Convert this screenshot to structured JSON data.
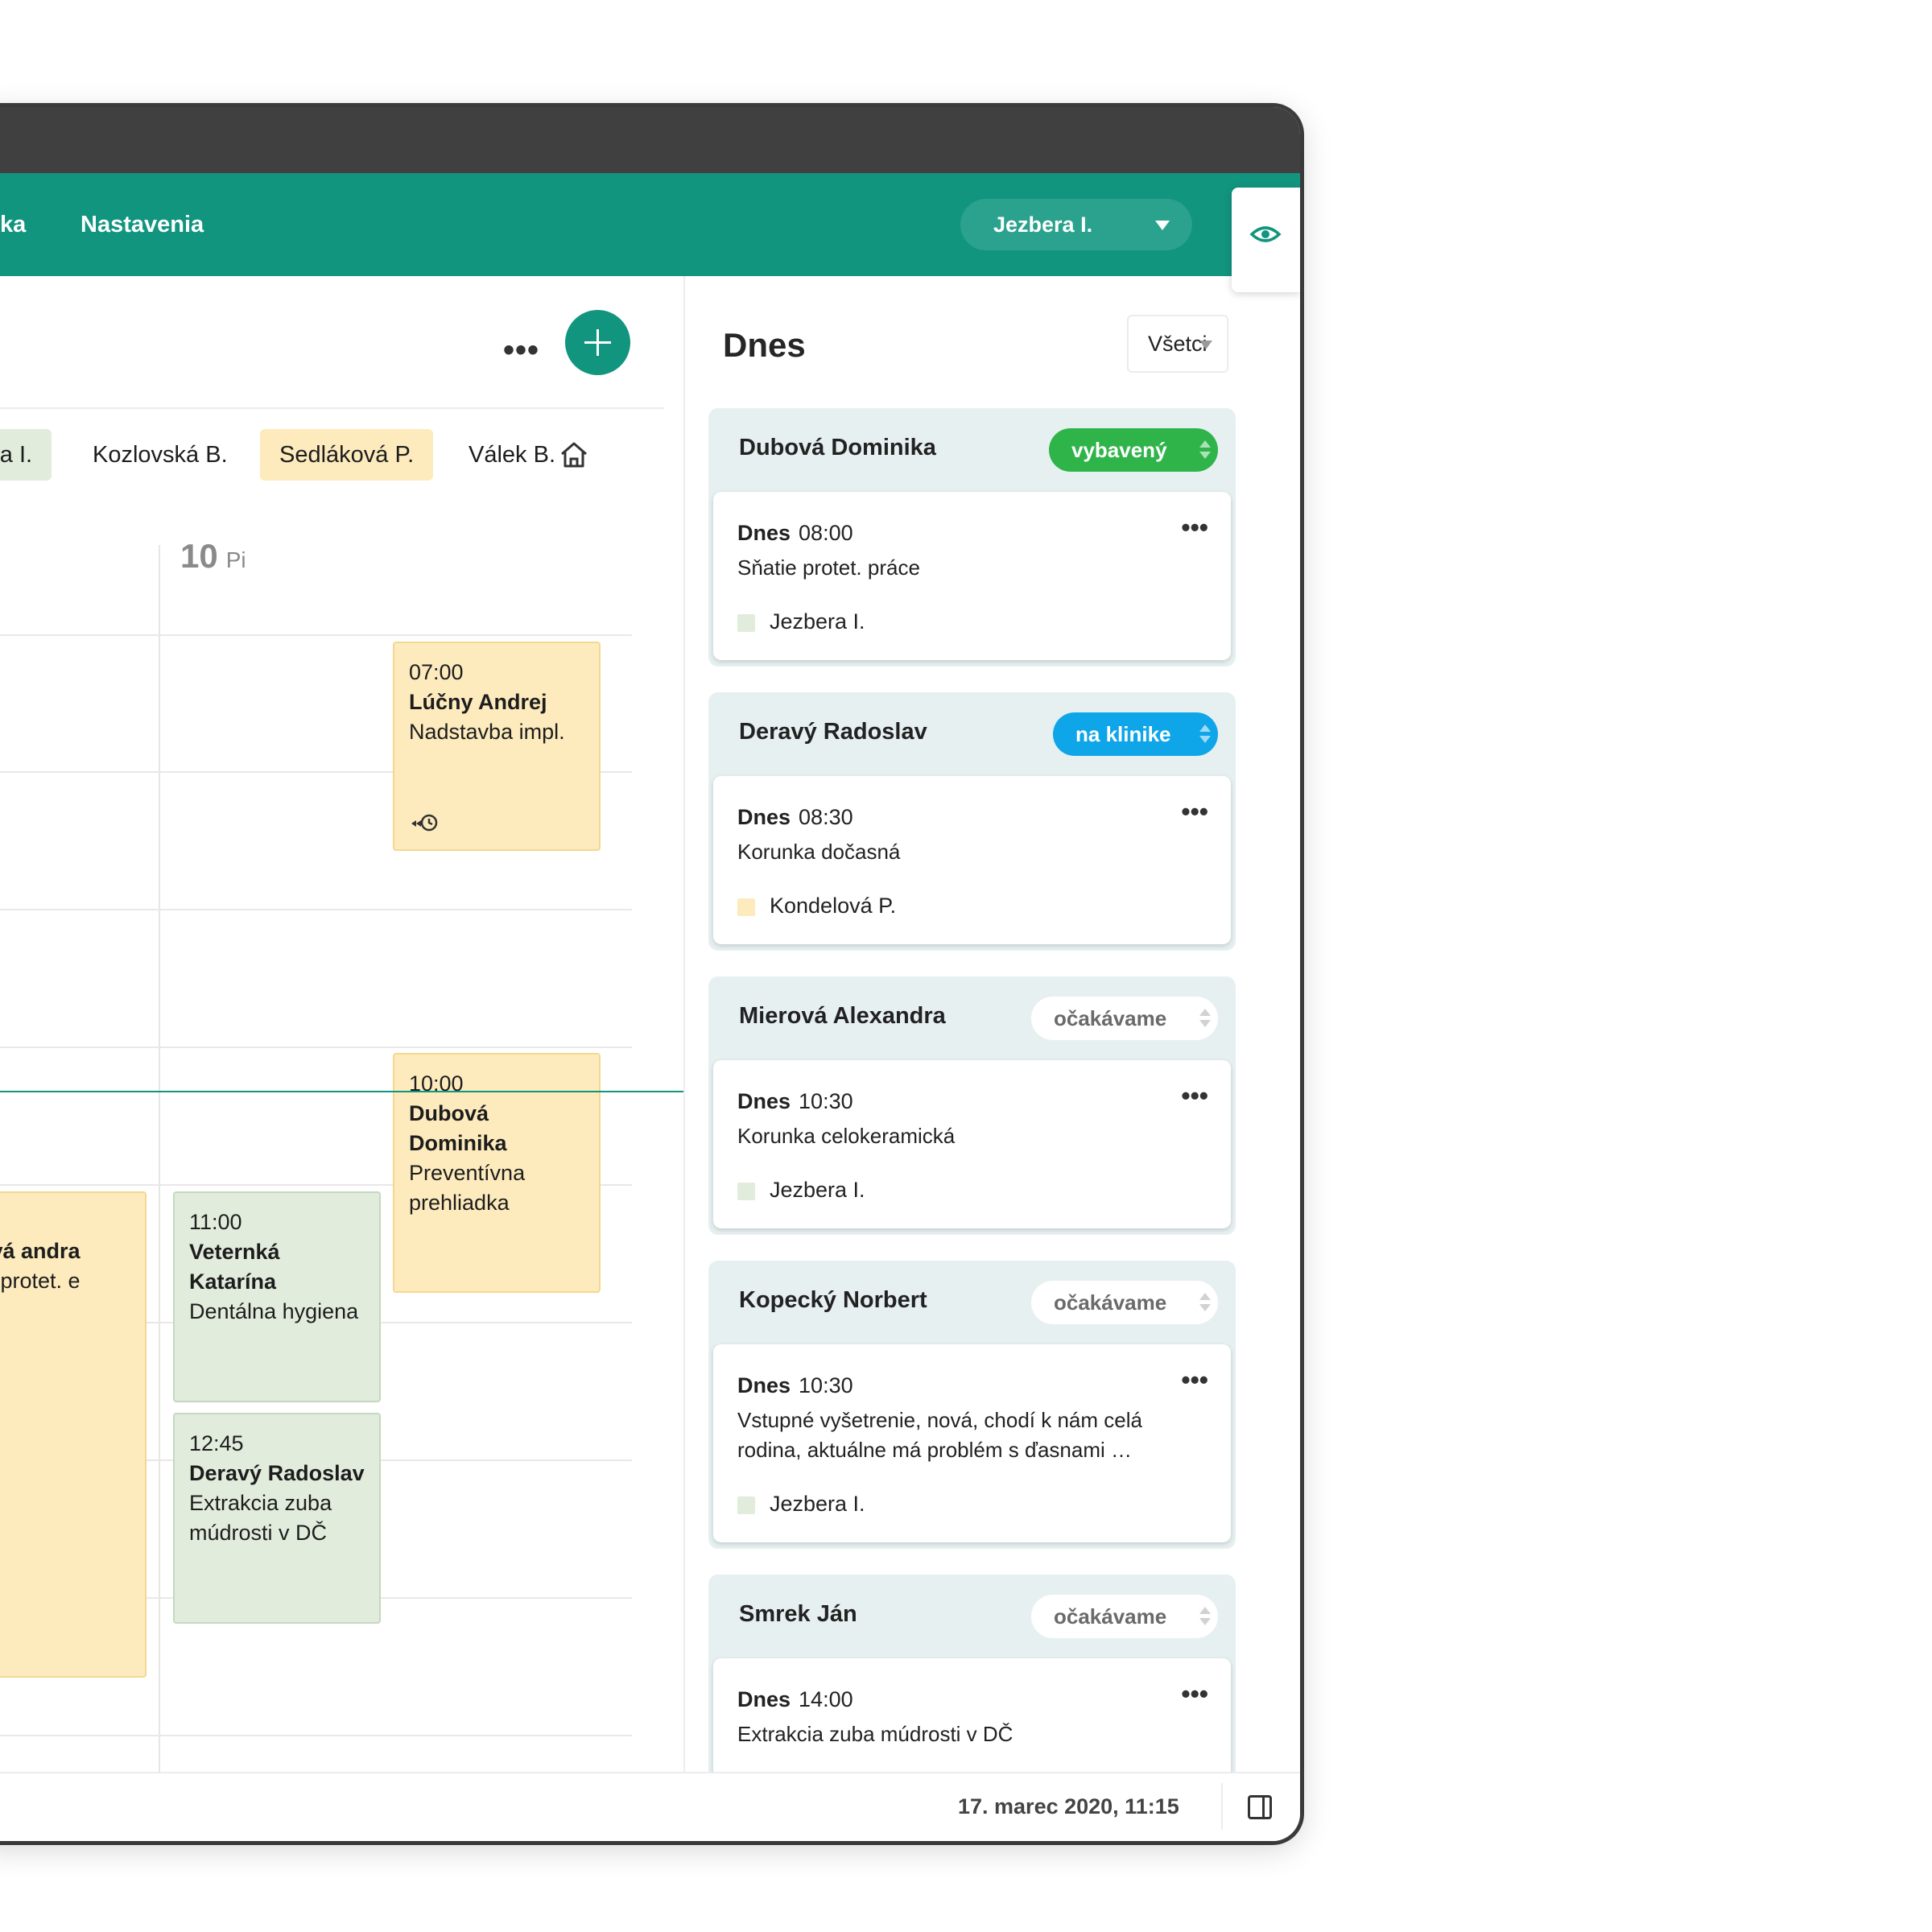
{
  "nav": {
    "links": [
      "ka",
      "Nastavenia"
    ],
    "user": "Jezbera I."
  },
  "toolbar": {
    "more_label": "•••"
  },
  "doctors": [
    "era I.",
    "Kozlovská B.",
    "Sedláková P.",
    "Válek B."
  ],
  "colors": {
    "primary": "#11957f",
    "yellow_event": "#fdebbd",
    "green_event": "#e2ecdd",
    "done": "#2fb44a",
    "clinic": "#0ea6e8"
  },
  "day": {
    "number": "10",
    "weekday": "Pi"
  },
  "events": [
    {
      "time": "07:00",
      "name": "Lúčny Andrej",
      "desc": "Nadstavba impl.",
      "color": "yellow"
    },
    {
      "time": "10:00",
      "name": "Dubová Dominika",
      "desc": "Preventívna prehliadka",
      "color": "yellow"
    },
    {
      "time": "11:00",
      "name": "Veternká Katarína",
      "desc": "Dentálna hygiena",
      "color": "green"
    },
    {
      "time": "12:45",
      "name": "Deravý Radoslav",
      "desc": "Extrakcia zuba múdrosti v DČ",
      "color": "green"
    },
    {
      "time": "",
      "name": "ová andra",
      "desc": "ie protet. e",
      "color": "yellow"
    }
  ],
  "panel": {
    "title": "Dnes",
    "filter": "Všetci",
    "appointments": [
      {
        "patient": "Dubová Dominika",
        "status": "vybavený",
        "day": "Dnes",
        "time": "08:00",
        "desc": "Sňatie protet. práce",
        "doctor": "Jezbera I."
      },
      {
        "patient": "Deravý Radoslav",
        "status": "na klinike",
        "day": "Dnes",
        "time": "08:30",
        "desc": "Korunka dočasná",
        "doctor": "Kondelová P."
      },
      {
        "patient": "Mierová Alexandra",
        "status": "očakávame",
        "day": "Dnes",
        "time": "10:30",
        "desc": "Korunka celokeramická",
        "doctor": "Jezbera I."
      },
      {
        "patient": "Kopecký Norbert",
        "status": "očakávame",
        "day": "Dnes",
        "time": "10:30",
        "desc": "Vstupné vyšetrenie, nová, chodí k nám celá rodina, aktuálne má problém s ďasnami …",
        "doctor": "Jezbera I."
      },
      {
        "patient": "Smrek Ján",
        "status": "očakávame",
        "day": "Dnes",
        "time": "14:00",
        "desc": "Extrakcia zuba múdrosti v DČ",
        "doctor": ""
      }
    ]
  },
  "footer": {
    "datetime": "17. marec 2020,  11:15"
  }
}
